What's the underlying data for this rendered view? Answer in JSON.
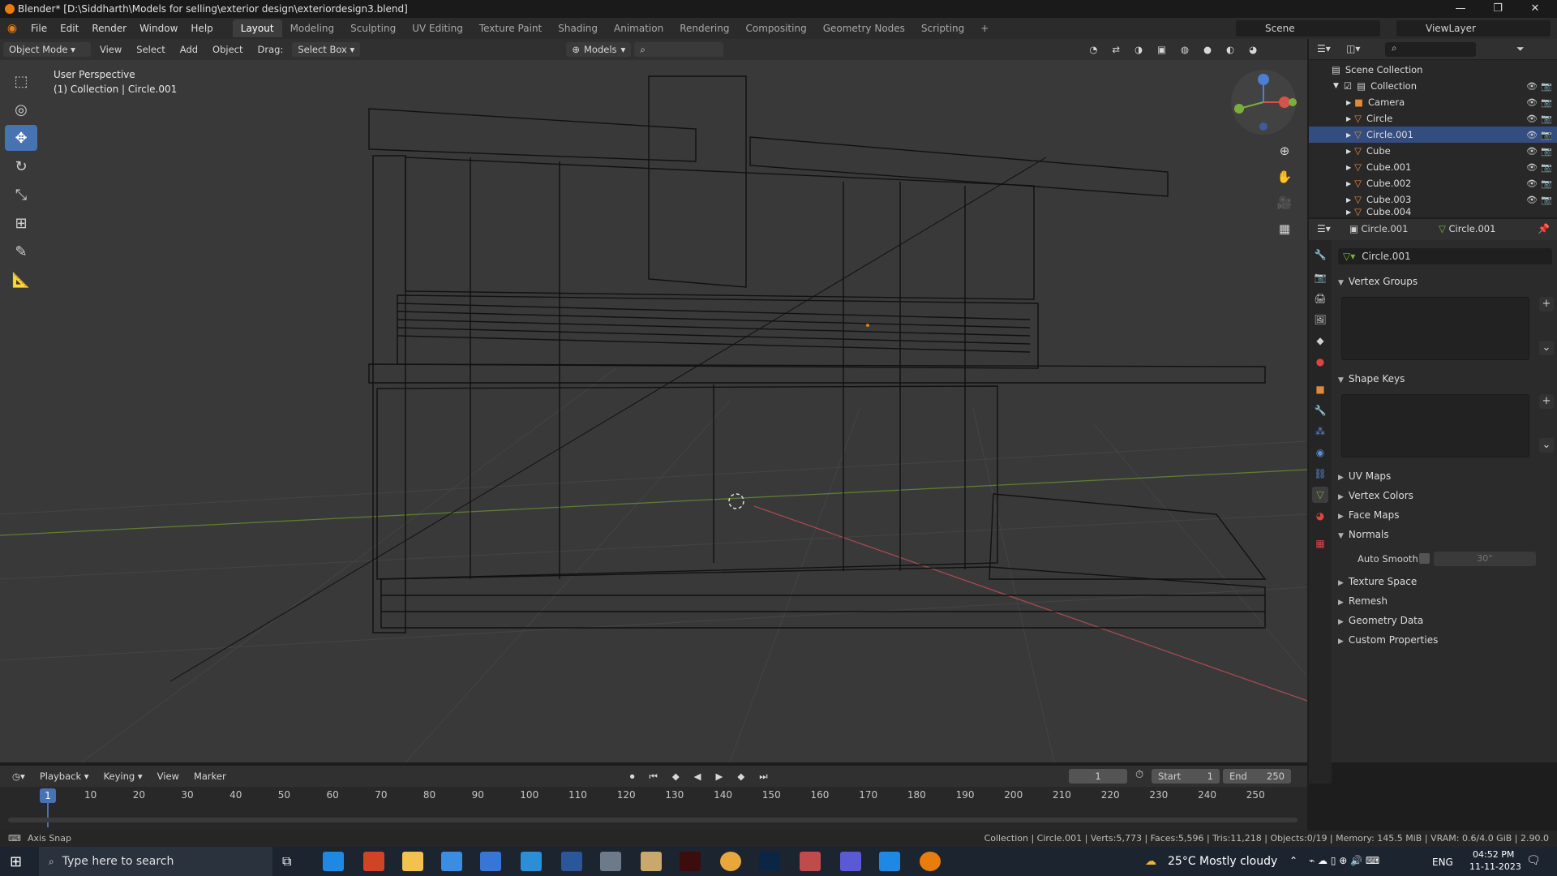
{
  "window": {
    "title": "Blender* [D:\\Siddharth\\Models for selling\\exterior design\\exteriordesign3.blend]",
    "minimize": "—",
    "maximize": "❐",
    "close": "✕"
  },
  "menu": [
    "File",
    "Edit",
    "Render",
    "Window",
    "Help"
  ],
  "workspaces": [
    "Layout",
    "Modeling",
    "Sculpting",
    "UV Editing",
    "Texture Paint",
    "Shading",
    "Animation",
    "Rendering",
    "Compositing",
    "Geometry Nodes",
    "Scripting"
  ],
  "workspace_add": "+",
  "scene": {
    "label": "Scene",
    "viewlayer": "ViewLayer"
  },
  "header": {
    "mode": "Object Mode",
    "view": "View",
    "select": "Select",
    "add": "Add",
    "object": "Object",
    "drag_label": "Drag:",
    "drag_value": "Select Box",
    "orientation": "Models"
  },
  "viewport": {
    "perspective": "User Perspective",
    "collection_info": "(1) Collection | Circle.001"
  },
  "outliner": {
    "root": "Scene Collection",
    "collection": "Collection",
    "items": [
      "Camera",
      "Circle",
      "Circle.001",
      "Cube",
      "Cube.001",
      "Cube.002",
      "Cube.003",
      "Cube.004"
    ]
  },
  "properties": {
    "object_name": "Circle.001",
    "data_name": "Circle.001",
    "mesh_name": "Circle.001",
    "panels": {
      "vertex_groups": "Vertex Groups",
      "shape_keys": "Shape Keys",
      "uv_maps": "UV Maps",
      "vertex_colors": "Vertex Colors",
      "face_maps": "Face Maps",
      "normals": "Normals",
      "auto_smooth": "Auto Smooth",
      "auto_smooth_angle": "30°",
      "texture_space": "Texture Space",
      "remesh": "Remesh",
      "geometry_data": "Geometry Data",
      "custom_properties": "Custom Properties"
    }
  },
  "timeline": {
    "playback": "Playback",
    "keying": "Keying",
    "view": "View",
    "marker": "Marker",
    "current_frame": "1",
    "start_label": "Start",
    "start": "1",
    "end_label": "End",
    "end": "250",
    "frame_marker": "1",
    "ticks": [
      "10",
      "20",
      "30",
      "40",
      "50",
      "60",
      "70",
      "80",
      "90",
      "100",
      "110",
      "120",
      "130",
      "140",
      "150",
      "160",
      "170",
      "180",
      "190",
      "200",
      "210",
      "220",
      "230",
      "240",
      "250"
    ]
  },
  "status": {
    "left": "Axis Snap",
    "right": "Collection | Circle.001 | Verts:5,773 | Faces:5,596 | Tris:11,218 | Objects:0/19 | Memory: 145.5 MiB | VRAM: 0.6/4.0 GiB | 2.90.0"
  },
  "taskbar": {
    "search_placeholder": "Type here to search",
    "weather": "25°C  Mostly cloudy",
    "lang": "ENG",
    "time": "04:52 PM",
    "date": "11-11-2023"
  },
  "colors": {
    "accent": "#4772b3",
    "x_axis": "#b34c52",
    "y_axis": "#6a9a2e"
  }
}
